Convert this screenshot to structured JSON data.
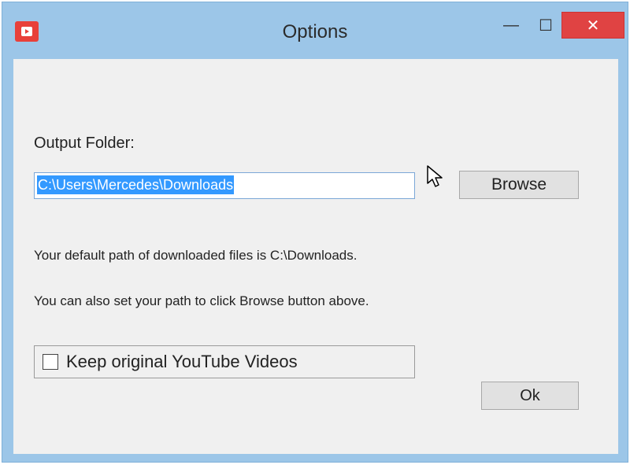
{
  "window": {
    "title": "Options",
    "icon": "youtube-play-icon",
    "controls": {
      "minimize": "—",
      "maximize": "☐",
      "close": "✕"
    }
  },
  "form": {
    "output_label": "Output Folder:",
    "path_value": "C:\\Users\\Mercedes\\Downloads",
    "browse_label": "Browse",
    "info_default": "Your default path of downloaded files is C:\\Downloads.",
    "info_browse": "You can also set your path to click Browse button above.",
    "keep_label": "Keep original YouTube Videos",
    "keep_checked": false,
    "ok_label": "Ok"
  },
  "colors": {
    "frame": "#9cc6e8",
    "close": "#e04343",
    "selection": "#3399ff",
    "client": "#f0f0f0"
  }
}
